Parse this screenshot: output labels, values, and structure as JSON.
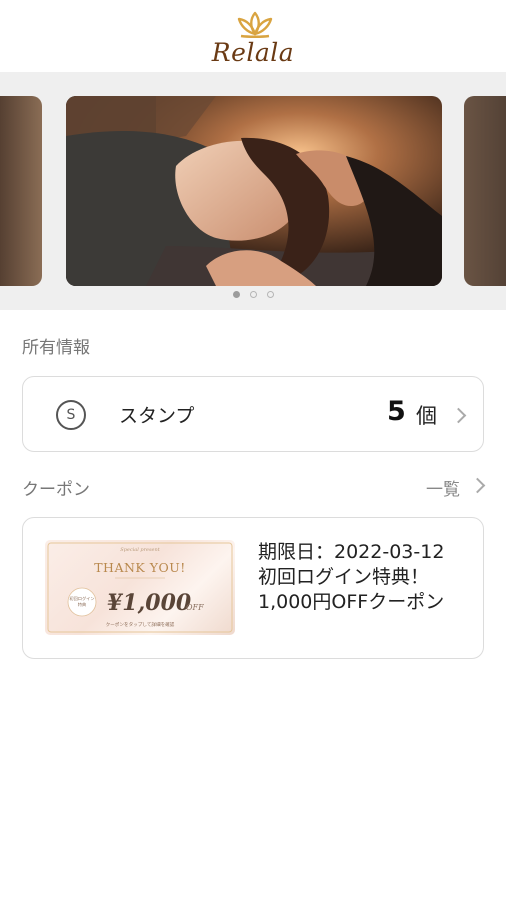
{
  "header": {
    "logo_text": "Relala"
  },
  "carousel": {
    "dots": 3,
    "active_index": 0
  },
  "holdings": {
    "section_title": "所有情報",
    "stamp": {
      "icon_letter": "S",
      "label": "スタンプ",
      "count": "5",
      "unit": "個"
    }
  },
  "coupons": {
    "section_title": "クーポン",
    "view_all_label": "一覧",
    "items": [
      {
        "image": {
          "script_text": "Special present",
          "headline": "THANK YOU!",
          "badge_line1": "初回ログイン",
          "badge_line2": "特典",
          "amount": "¥1,000",
          "off": "OFF",
          "footer": "クーポンをタップして詳細を確認"
        },
        "expiry": "期限日：2022-03-12",
        "title_line1": "初回ログイン特典！",
        "title_line2": "1,000円OFFクーポン"
      }
    ]
  },
  "colors": {
    "brand": "#6a3a14",
    "logo_gold": "#d9a441"
  }
}
